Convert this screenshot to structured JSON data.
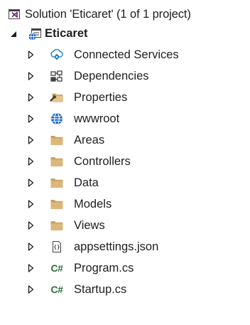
{
  "solution": {
    "label": "Solution 'Eticaret' (1 of 1 project)",
    "icon": "solution-icon"
  },
  "project": {
    "label": "Eticaret",
    "icon": "web-project-icon",
    "expanded": true
  },
  "items": [
    {
      "label": "Connected Services",
      "icon": "connected-services-icon"
    },
    {
      "label": "Dependencies",
      "icon": "dependencies-icon"
    },
    {
      "label": "Properties",
      "icon": "properties-icon"
    },
    {
      "label": "wwwroot",
      "icon": "globe-icon"
    },
    {
      "label": "Areas",
      "icon": "folder-icon"
    },
    {
      "label": "Controllers",
      "icon": "folder-icon"
    },
    {
      "label": "Data",
      "icon": "folder-icon"
    },
    {
      "label": "Models",
      "icon": "folder-icon"
    },
    {
      "label": "Views",
      "icon": "folder-icon"
    },
    {
      "label": "appsettings.json",
      "icon": "json-file-icon"
    },
    {
      "label": "Program.cs",
      "icon": "csharp-file-icon",
      "glyph": "C#"
    },
    {
      "label": "Startup.cs",
      "icon": "csharp-file-icon",
      "glyph": "C#"
    }
  ],
  "colors": {
    "folder": "#dcb67a",
    "folder_dark": "#c19a55",
    "solution_purple": "#68217a",
    "globe_blue": "#1b6ac9",
    "csharp_green": "#2d6e3e",
    "arrow": "#1e1e1e"
  }
}
